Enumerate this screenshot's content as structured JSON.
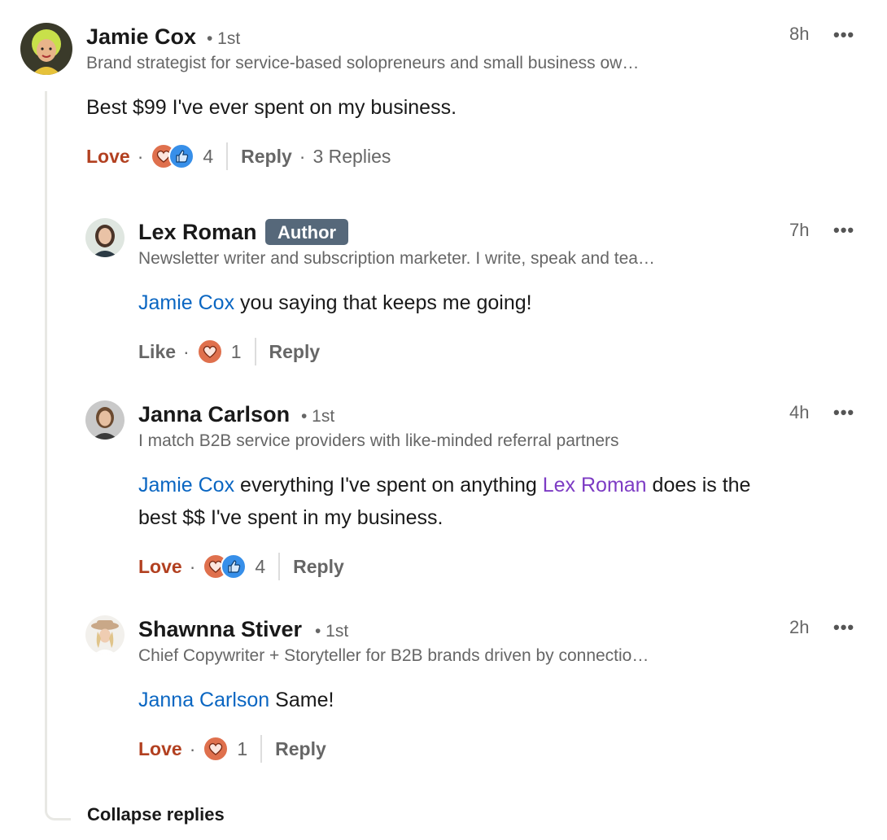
{
  "comments": [
    {
      "name": "Jamie Cox",
      "degree": "• 1st",
      "headline": "Brand strategist for service-based solopreneurs and small business ow…",
      "time": "8h",
      "more": "•••",
      "text_parts": [
        "Best $99 I've ever spent on my business."
      ],
      "reaction": "Love",
      "dot": "·",
      "count": "4",
      "reply": "Reply",
      "replies_dot": "·",
      "replies": "3 Replies"
    },
    {
      "name": "Lex Roman",
      "badge": "Author",
      "headline": "Newsletter writer and subscription marketer. I write, speak and tea…",
      "time": "7h",
      "more": "•••",
      "mention1": "Jamie Cox",
      "text1": " you saying that keeps me going!",
      "reaction": "Like",
      "dot": "·",
      "count": "1",
      "reply": "Reply"
    },
    {
      "name": "Janna Carlson",
      "degree": "• 1st",
      "headline": "I match B2B service providers with like-minded referral partners",
      "time": "4h",
      "more": "•••",
      "mention1": "Jamie Cox",
      "text1": " everything I've spent on anything ",
      "mention2": "Lex Roman",
      "text2": " does is the",
      "text3": "best $$ I've spent in my business.",
      "reaction": "Love",
      "dot": "·",
      "count": "4",
      "reply": "Reply"
    },
    {
      "name": "Shawnna Stiver",
      "degree": "• 1st",
      "headline": "Chief Copywriter + Storyteller for B2B brands driven by connectio…",
      "time": "2h",
      "more": "•••",
      "mention1": "Janna Carlson",
      "text1": " Same!",
      "reaction": "Love",
      "dot": "·",
      "count": "1",
      "reply": "Reply"
    }
  ],
  "collapse_label": "Collapse replies",
  "colors": {
    "love": "#b24020",
    "mention_blue": "#0a66c2",
    "mention_purple": "#7d3cc4",
    "author_badge": "#56687a",
    "muted": "#666666"
  }
}
